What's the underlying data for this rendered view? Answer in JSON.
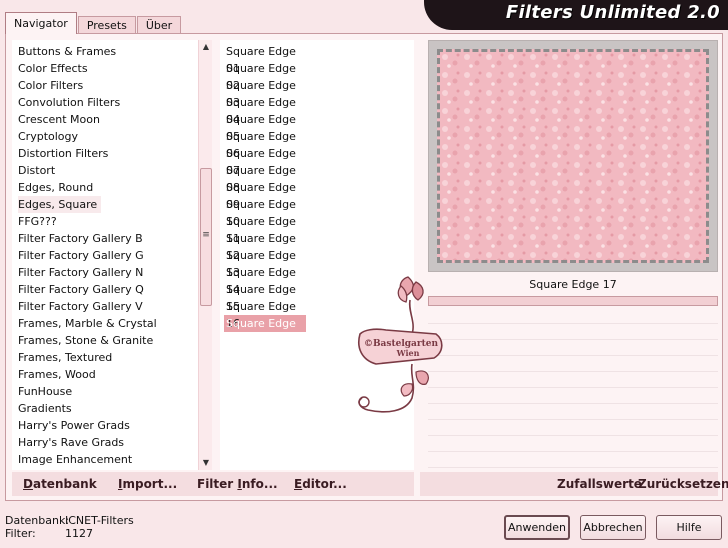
{
  "tabs": [
    {
      "label": "Navigator",
      "active": true
    },
    {
      "label": "Presets",
      "active": false
    },
    {
      "label": "Über",
      "active": false
    }
  ],
  "title": "Filters Unlimited 2.0",
  "categories": [
    "Buttons & Frames",
    "Color Effects",
    "Color Filters",
    "Convolution Filters",
    "Crescent Moon",
    "Cryptology",
    "Distortion Filters",
    "Distort",
    "Edges, Round",
    "Edges, Square",
    "FFG???",
    "Filter Factory Gallery B",
    "Filter Factory Gallery G",
    "Filter Factory Gallery N",
    "Filter Factory Gallery Q",
    "Filter Factory Gallery V",
    "Frames, Marble & Crystal",
    "Frames, Stone & Granite",
    "Frames, Textured",
    "Frames, Wood",
    "FunHouse",
    "Gradients",
    "Harry's Power Grads",
    "Harry's Rave Grads",
    "Image Enhancement"
  ],
  "selected_category": "Edges, Square",
  "filters": [
    "Square Edge 01",
    "Square Edge 02",
    "Square Edge 03",
    "Square Edge 04",
    "Square Edge 05",
    "Square Edge 06",
    "Square Edge 07",
    "Square Edge 08",
    "Square Edge 09",
    "Square Edge 10",
    "Square Edge 11",
    "Square Edge 12",
    "Square Edge 13",
    "Square Edge 14",
    "Square Edge 15",
    "Square Edge 16",
    "Square Edge 17"
  ],
  "selected_filter": "Square Edge 17",
  "preview_filter_name": "Square Edge 17",
  "watermark": {
    "line1": "©Bastelgarten",
    "line2": "Wien"
  },
  "links": {
    "datenbank": {
      "u": "D",
      "rest": "atenbank"
    },
    "import": {
      "u": "I",
      "rest": "mport..."
    },
    "filter_info": {
      "pre": "Filter ",
      "u": "I",
      "rest": "nfo..."
    },
    "editor": {
      "u": "E",
      "rest": "ditor..."
    },
    "zufallswerte": "Zufallswerte",
    "zuruecksetzen": "Zurücksetzen"
  },
  "status": {
    "db_label": "Datenbank:",
    "db_value": "ICNET-Filters",
    "filter_label": "Filter:",
    "filter_value": "1127"
  },
  "buttons": {
    "apply": "Anwenden",
    "cancel": "Abbrechen",
    "help": "Hilfe"
  },
  "colors": {
    "background": "#f9e7e9",
    "selection": "#e9a1a8",
    "preview_pink": "#f2b9c1",
    "banner": "#1e1418"
  }
}
